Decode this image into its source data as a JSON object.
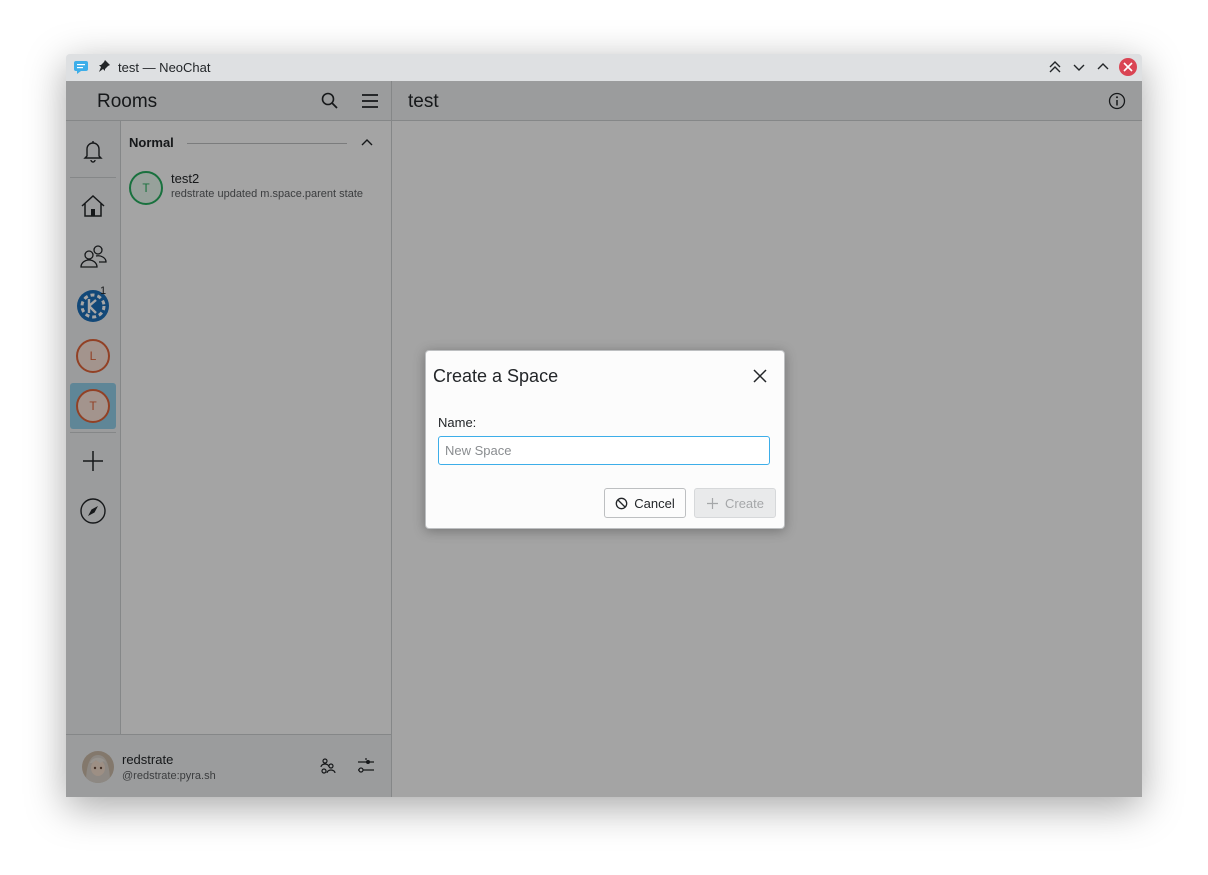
{
  "window": {
    "title": "test — NeoChat"
  },
  "header": {
    "rooms_title": "Rooms",
    "room_title": "test"
  },
  "spaces": {
    "items": [
      {
        "name": "notifications",
        "icon": "bell-icon"
      },
      {
        "name": "home",
        "icon": "home-icon"
      },
      {
        "name": "direct-messages",
        "icon": "people-icon"
      },
      {
        "name": "kde-space",
        "icon": "kde-gear-icon",
        "badge": "1"
      },
      {
        "name": "space-l",
        "letter": "L"
      },
      {
        "name": "space-t",
        "letter": "T",
        "active": true
      },
      {
        "name": "create-space",
        "icon": "plus-icon"
      },
      {
        "name": "explore",
        "icon": "compass-icon"
      }
    ]
  },
  "roomlist": {
    "section_label": "Normal",
    "rooms": [
      {
        "letter": "T",
        "name": "test2",
        "last_message": "redstrate updated m.space.parent state"
      }
    ]
  },
  "user": {
    "display_name": "redstrate",
    "user_id": "@redstrate:pyra.sh"
  },
  "dialog": {
    "title": "Create a Space",
    "name_label": "Name:",
    "name_placeholder": "New Space",
    "name_value": "",
    "cancel_label": "Cancel",
    "create_label": "Create"
  },
  "colors": {
    "accent": "#3daee9",
    "close_button": "#da4453",
    "letter_avatar": "#e0643a",
    "room_avatar": "#27ae60"
  }
}
